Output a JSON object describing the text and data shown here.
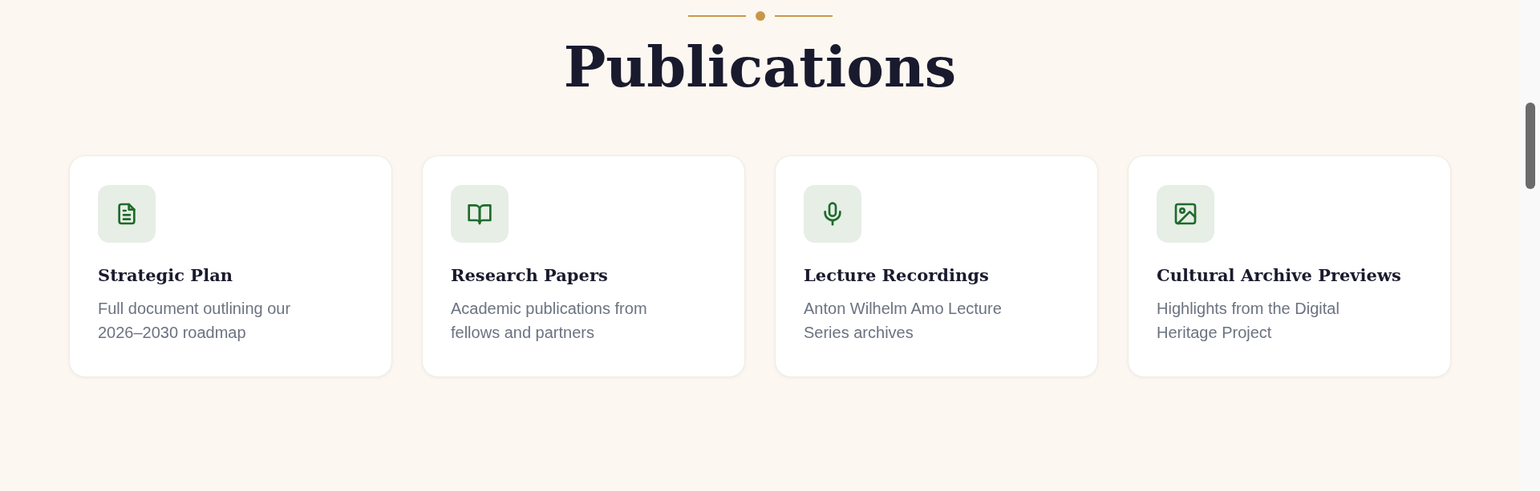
{
  "section": {
    "title": "Publications"
  },
  "cards": [
    {
      "title": "Strategic Plan",
      "description": "Full document outlining our 2026–2030 roadmap"
    },
    {
      "title": "Research Papers",
      "description": "Academic publications from fellows and partners"
    },
    {
      "title": "Lecture Recordings",
      "description": "Anton Wilhelm Amo Lecture Series archives"
    },
    {
      "title": "Cultural Archive Previews",
      "description": "Highlights from the Digital Heritage Project"
    }
  ]
}
